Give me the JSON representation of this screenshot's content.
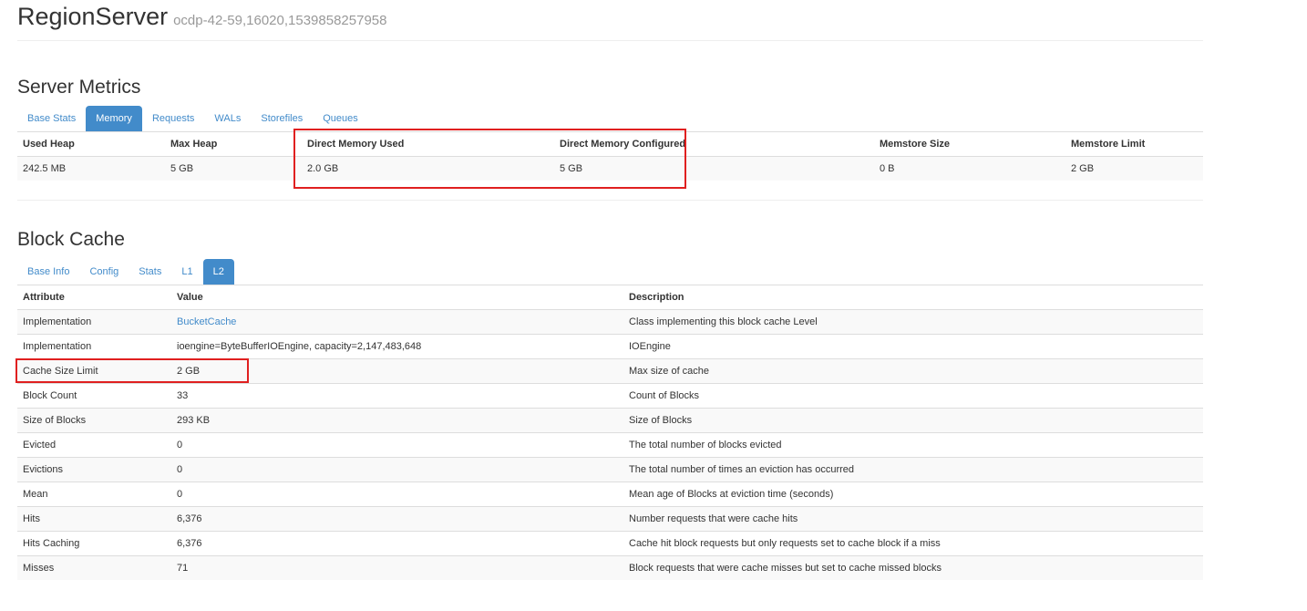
{
  "header": {
    "title": "RegionServer",
    "server_name": "ocdp-42-59,16020,1539858257958"
  },
  "server_metrics": {
    "title": "Server Metrics",
    "tabs": [
      "Base Stats",
      "Memory",
      "Requests",
      "WALs",
      "Storefiles",
      "Queues"
    ],
    "active_tab": "Memory",
    "columns": [
      "Used Heap",
      "Max Heap",
      "Direct Memory Used",
      "Direct Memory Configured",
      "Memstore Size",
      "Memstore Limit"
    ],
    "row": [
      "242.5 MB",
      "5 GB",
      "2.0 GB",
      "5 GB",
      "0 B",
      "2 GB"
    ]
  },
  "block_cache": {
    "title": "Block Cache",
    "tabs": [
      "Base Info",
      "Config",
      "Stats",
      "L1",
      "L2"
    ],
    "active_tab": "L2",
    "columns": [
      "Attribute",
      "Value",
      "Description"
    ],
    "rows": [
      {
        "attribute": "Implementation",
        "value": "BucketCache",
        "description": "Class implementing this block cache Level"
      },
      {
        "attribute": "Implementation",
        "value": "ioengine=ByteBufferIOEngine, capacity=2,147,483,648",
        "description": "IOEngine"
      },
      {
        "attribute": "Cache Size Limit",
        "value": "2 GB",
        "description": "Max size of cache"
      },
      {
        "attribute": "Block Count",
        "value": "33",
        "description": "Count of Blocks"
      },
      {
        "attribute": "Size of Blocks",
        "value": "293 KB",
        "description": "Size of Blocks"
      },
      {
        "attribute": "Evicted",
        "value": "0",
        "description": "The total number of blocks evicted"
      },
      {
        "attribute": "Evictions",
        "value": "0",
        "description": "The total number of times an eviction has occurred"
      },
      {
        "attribute": "Mean",
        "value": "0",
        "description": "Mean age of Blocks at eviction time (seconds)"
      },
      {
        "attribute": "Hits",
        "value": "6,376",
        "description": "Number requests that were cache hits"
      },
      {
        "attribute": "Hits Caching",
        "value": "6,376",
        "description": "Cache hit block requests but only requests set to cache block if a miss"
      },
      {
        "attribute": "Misses",
        "value": "71",
        "description": "Block requests that were cache misses but set to cache missed blocks"
      }
    ]
  },
  "colors": {
    "accent": "#428bca",
    "highlight": "#e02020"
  }
}
